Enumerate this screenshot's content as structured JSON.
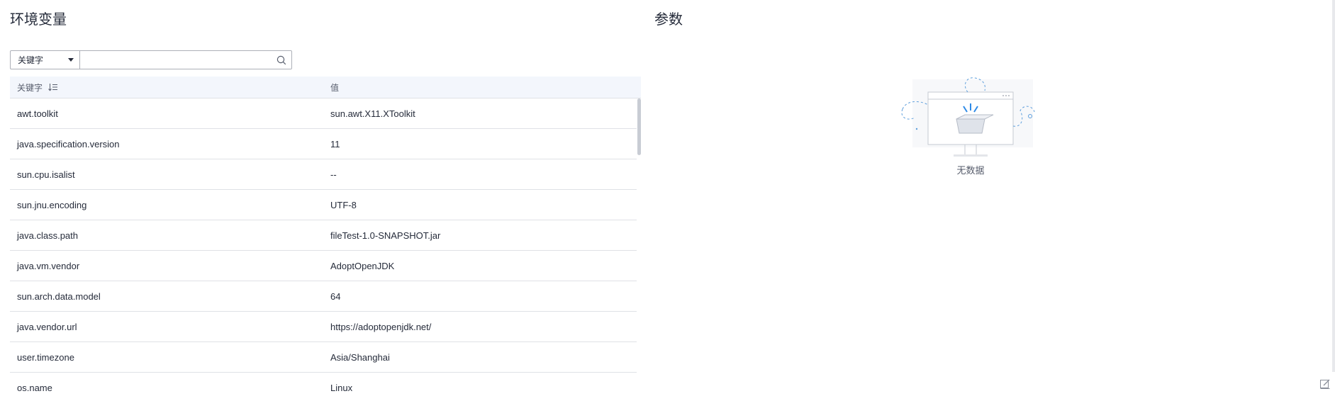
{
  "env_section": {
    "title": "环境变量",
    "filter": {
      "selected": "关键字",
      "input_value": "",
      "placeholder": ""
    },
    "table": {
      "columns": [
        "关键字",
        "值"
      ],
      "rows": [
        {
          "key": "awt.toolkit",
          "value": "sun.awt.X11.XToolkit"
        },
        {
          "key": "java.specification.version",
          "value": "11"
        },
        {
          "key": "sun.cpu.isalist",
          "value": "--"
        },
        {
          "key": "sun.jnu.encoding",
          "value": "UTF-8"
        },
        {
          "key": "java.class.path",
          "value": "fileTest-1.0-SNAPSHOT.jar"
        },
        {
          "key": "java.vm.vendor",
          "value": "AdoptOpenJDK"
        },
        {
          "key": "sun.arch.data.model",
          "value": "64"
        },
        {
          "key": "java.vendor.url",
          "value": "https://adoptopenjdk.net/"
        },
        {
          "key": "user.timezone",
          "value": "Asia/Shanghai"
        },
        {
          "key": "os.name",
          "value": "Linux"
        }
      ]
    },
    "icons": {
      "dropdown": "chevron-down-icon",
      "search": "search-icon",
      "sort": "sort-icon"
    }
  },
  "params_section": {
    "title": "参数",
    "empty_text": "无数据",
    "empty_icon": "empty-box-icon"
  },
  "colors": {
    "header_bg": "#f3f6fc",
    "border": "#dfe1e6",
    "accent": "#5e9fdc",
    "text": "#252b3a"
  }
}
